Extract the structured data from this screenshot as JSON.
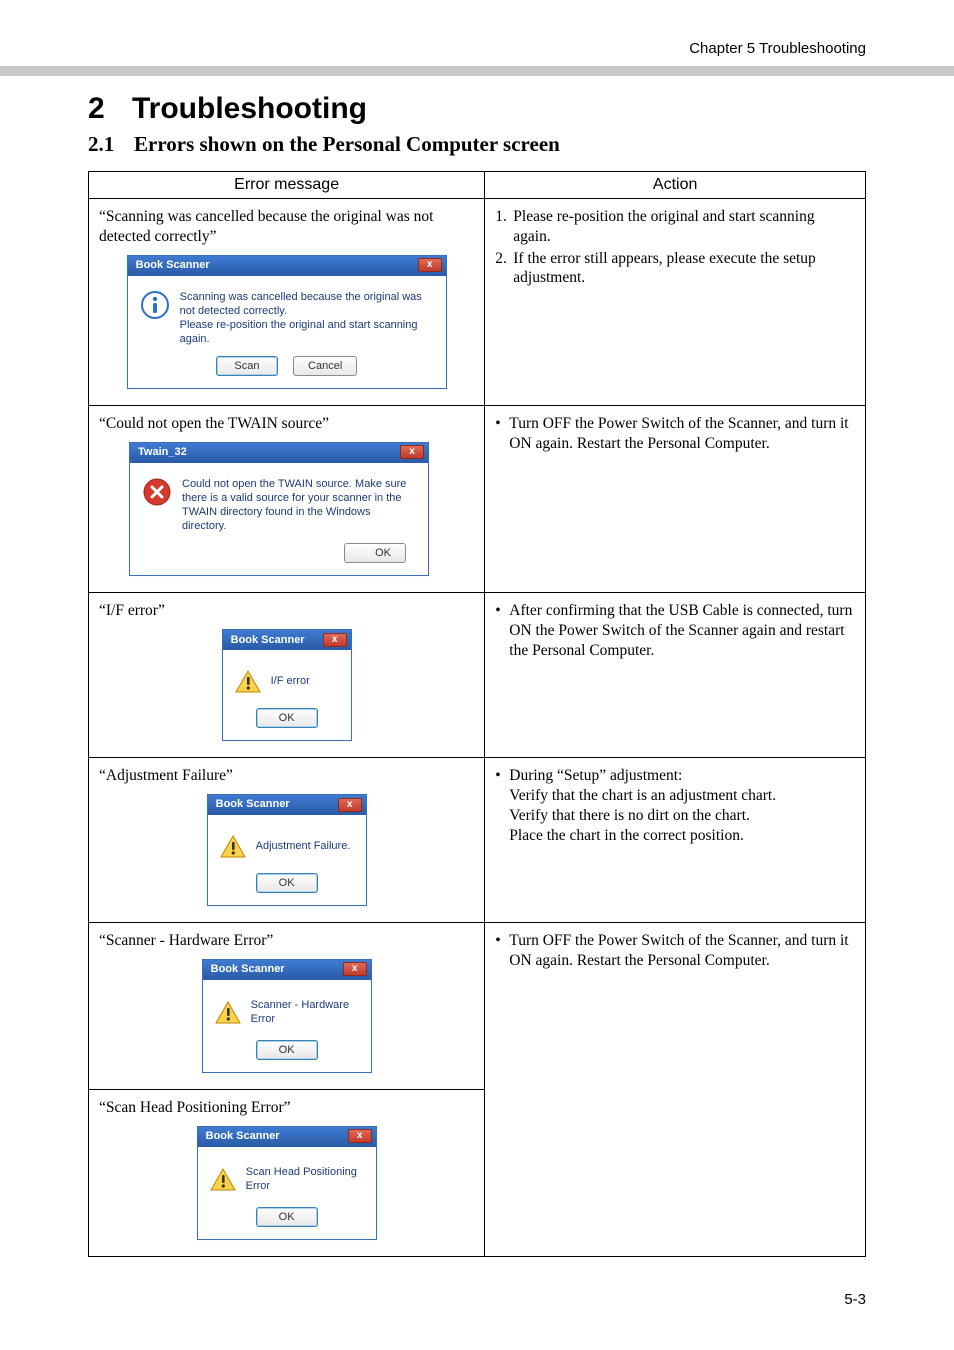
{
  "runningHead": "Chapter 5 Troubleshooting",
  "section": {
    "number": "2",
    "title": "Troubleshooting"
  },
  "subsection": {
    "number": "2.1",
    "title": "Errors shown on the Personal Computer screen"
  },
  "headers": {
    "left": "Error message",
    "right": "Action"
  },
  "pageNumber": "5-3",
  "buttons": {
    "scan": "Scan",
    "cancel": "Cancel",
    "ok": "OK"
  },
  "dialogs": {
    "bookScannerTitle": "Book Scanner",
    "twainTitle": "Twain_32",
    "scanCancelledMsg": "Scanning was cancelled because the original was not detected correctly.\nPlease re-position the original and start scanning again.",
    "twainMsg": "Could not open the TWAIN source. Make sure there is a valid source for your scanner in the TWAIN directory found in the Windows directory.",
    "ifError": "I/F error",
    "adjFailure": "Adjustment Failure.",
    "hwError": "Scanner - Hardware Error",
    "headPosError": "Scan Head Positioning Error"
  },
  "rows": {
    "r1": {
      "errLabel": "“Scanning was cancelled because the original was not detected correctly”",
      "action": {
        "n1": "Please re-position the original and start scanning again.",
        "n2": "If the error still appears, please execute the setup adjustment."
      }
    },
    "r2": {
      "errLabel": "“Could not open the TWAIN source”",
      "action": "Turn OFF the Power Switch of the Scanner, and turn it ON again. Restart the Personal Computer."
    },
    "r3": {
      "errLabel": "“I/F error”",
      "action": "After confirming that the USB Cable is connected, turn ON the Power Switch of the Scanner again and restart the Personal Computer."
    },
    "r4": {
      "errLabel": "“Adjustment Failure”",
      "action": {
        "l1": "During “Setup” adjustment:",
        "l2": "Verify that the chart is an adjustment chart.",
        "l3": "Verify that there is no dirt on the chart.",
        "l4": "Place the chart in the correct position."
      }
    },
    "r5": {
      "errLabel": "“Scanner - Hardware Error”",
      "action": "Turn OFF the Power Switch of the Scanner, and turn it ON again. Restart the Personal Computer."
    },
    "r6": {
      "errLabel": "“Scan Head Positioning Error”"
    }
  }
}
